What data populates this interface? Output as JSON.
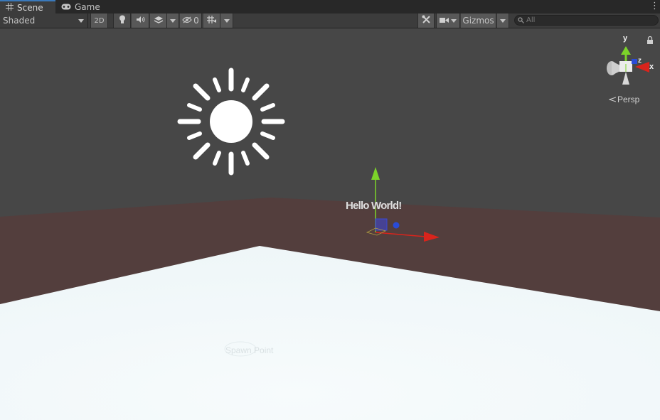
{
  "tabs": [
    {
      "label": "Scene",
      "icon": "grid-icon",
      "active": true
    },
    {
      "label": "Game",
      "icon": "gamepad-icon",
      "active": false
    }
  ],
  "toolbar": {
    "shading_mode": "Shaded",
    "toggle_2d": "2D",
    "hidden_count": "0",
    "gizmos_label": "Gizmos",
    "search_placeholder": "All"
  },
  "scene": {
    "hello_label": "Hello World!",
    "spawn_label": "Spawn Point",
    "projection_label": "Persp",
    "axes": {
      "x": "x",
      "y": "y",
      "z": "z"
    },
    "colors": {
      "sky": "#474747",
      "wall": "#533e3d",
      "floor": "#f2f8fa",
      "axis_x": "#d9241c",
      "axis_y": "#7cd32a",
      "axis_z": "#2a4bd6"
    }
  }
}
